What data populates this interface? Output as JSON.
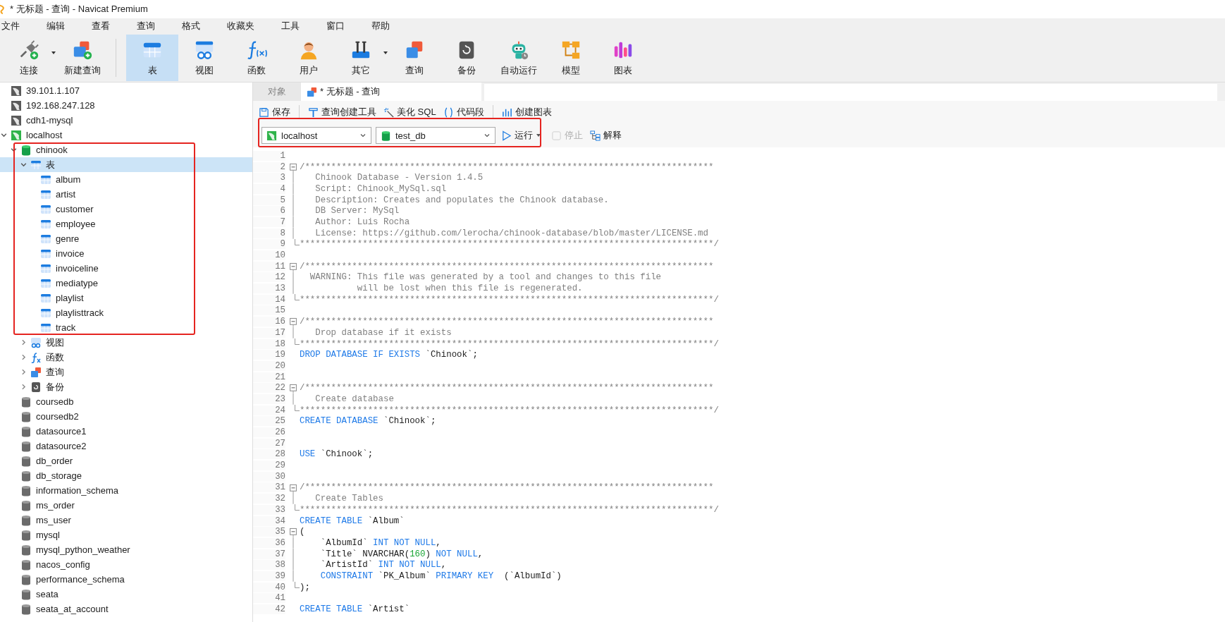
{
  "window": {
    "title": "* 无标题 - 查询 - Navicat Premium"
  },
  "menu": [
    "文件",
    "编辑",
    "查看",
    "查询",
    "格式",
    "收藏夹",
    "工具",
    "窗口",
    "帮助"
  ],
  "toolbar": {
    "groups": [
      [
        {
          "kind": "connect",
          "label": "连接",
          "dropdown": true,
          "selected": false
        },
        {
          "kind": "new-query",
          "label": "新建查询",
          "dropdown": false,
          "selected": false
        }
      ],
      [
        {
          "kind": "table",
          "label": "表",
          "dropdown": false,
          "selected": true
        },
        {
          "kind": "view",
          "label": "视图",
          "dropdown": false,
          "selected": false
        },
        {
          "kind": "function",
          "label": "函数",
          "dropdown": false,
          "selected": false
        },
        {
          "kind": "user",
          "label": "用户",
          "dropdown": false,
          "selected": false
        },
        {
          "kind": "tools",
          "label": "其它",
          "dropdown": true,
          "selected": false
        },
        {
          "kind": "query",
          "label": "查询",
          "dropdown": false,
          "selected": false
        },
        {
          "kind": "backup",
          "label": "备份",
          "dropdown": false,
          "selected": false
        },
        {
          "kind": "robot",
          "label": "自动运行",
          "dropdown": false,
          "selected": false
        },
        {
          "kind": "model",
          "label": "模型",
          "dropdown": false,
          "selected": false
        },
        {
          "kind": "chart",
          "label": "图表",
          "dropdown": false,
          "selected": false
        }
      ]
    ]
  },
  "tree": [
    {
      "kind": "server",
      "label": "39.101.1.107",
      "open": false,
      "selected": false
    },
    {
      "kind": "server",
      "label": "192.168.247.128",
      "open": false,
      "selected": false
    },
    {
      "kind": "server",
      "label": "cdh1-mysql",
      "open": false,
      "selected": false
    },
    {
      "kind": "server",
      "label": "localhost",
      "open": true,
      "selected": false,
      "expanded": true,
      "children": [
        {
          "kind": "database",
          "label": "chinook",
          "open": true,
          "selected": false,
          "expanded": true,
          "children": [
            {
              "kind": "tables",
              "label": "表",
              "selected": true,
              "expanded": true,
              "children": [
                {
                  "kind": "table",
                  "label": "album",
                  "selected": false
                },
                {
                  "kind": "table",
                  "label": "artist",
                  "selected": false
                },
                {
                  "kind": "table",
                  "label": "customer",
                  "selected": false
                },
                {
                  "kind": "table",
                  "label": "employee",
                  "selected": false
                },
                {
                  "kind": "table",
                  "label": "genre",
                  "selected": false
                },
                {
                  "kind": "table",
                  "label": "invoice",
                  "selected": false
                },
                {
                  "kind": "table",
                  "label": "invoiceline",
                  "selected": false
                },
                {
                  "kind": "table",
                  "label": "mediatype",
                  "selected": false
                },
                {
                  "kind": "table",
                  "label": "playlist",
                  "selected": false
                },
                {
                  "kind": "table",
                  "label": "playlisttrack",
                  "selected": false
                },
                {
                  "kind": "table",
                  "label": "track",
                  "selected": false
                }
              ]
            },
            {
              "kind": "views",
              "label": "视图",
              "selected": false,
              "expanded": false
            },
            {
              "kind": "functions",
              "label": "函数",
              "selected": false,
              "expanded": false
            },
            {
              "kind": "queries",
              "label": "查询",
              "selected": false,
              "expanded": false
            },
            {
              "kind": "backups",
              "label": "备份",
              "selected": false,
              "expanded": false
            }
          ]
        },
        {
          "kind": "database",
          "label": "coursedb",
          "open": false,
          "selected": false
        },
        {
          "kind": "database",
          "label": "coursedb2",
          "open": false,
          "selected": false
        },
        {
          "kind": "database",
          "label": "datasource1",
          "open": false,
          "selected": false
        },
        {
          "kind": "database",
          "label": "datasource2",
          "open": false,
          "selected": false
        },
        {
          "kind": "database",
          "label": "db_order",
          "open": false,
          "selected": false
        },
        {
          "kind": "database",
          "label": "db_storage",
          "open": false,
          "selected": false
        },
        {
          "kind": "database",
          "label": "information_schema",
          "open": false,
          "selected": false
        },
        {
          "kind": "database",
          "label": "ms_order",
          "open": false,
          "selected": false
        },
        {
          "kind": "database",
          "label": "ms_user",
          "open": false,
          "selected": false
        },
        {
          "kind": "database",
          "label": "mysql",
          "open": false,
          "selected": false
        },
        {
          "kind": "database",
          "label": "mysql_python_weather",
          "open": false,
          "selected": false
        },
        {
          "kind": "database",
          "label": "nacos_config",
          "open": false,
          "selected": false
        },
        {
          "kind": "database",
          "label": "performance_schema",
          "open": false,
          "selected": false
        },
        {
          "kind": "database",
          "label": "seata",
          "open": false,
          "selected": false
        },
        {
          "kind": "database",
          "label": "seata_at_account",
          "open": false,
          "selected": false
        }
      ]
    }
  ],
  "tabs": [
    {
      "label": "对象",
      "kind": "plain",
      "selected": false
    },
    {
      "label": "* 无标题 - 查询",
      "kind": "query",
      "selected": true
    }
  ],
  "editor_toolbar": [
    {
      "kind": "save",
      "label": "保存"
    },
    {
      "kind": "builder",
      "label": "查询创建工具"
    },
    {
      "kind": "beautify",
      "label": "美化 SQL"
    },
    {
      "kind": "snippet",
      "label": "代码段"
    },
    {
      "kind": "chart",
      "label": "创建图表"
    }
  ],
  "run_bar": {
    "connection": "localhost",
    "database": "test_db",
    "run": "运行",
    "stop": "停止",
    "stop_disabled": true,
    "explain": "解释"
  },
  "code": [
    {
      "n": "1",
      "kind": "plain"
    },
    {
      "n": "2",
      "kind": "fold-start",
      "tokens": [
        {
          "kind": "comment",
          "text": "/******************************************************************************"
        }
      ]
    },
    {
      "n": "3",
      "kind": "fold-body",
      "tokens": [
        {
          "kind": "comment",
          "text": "   Chinook Database - Version 1.4.5"
        }
      ]
    },
    {
      "n": "4",
      "kind": "fold-body",
      "tokens": [
        {
          "kind": "comment",
          "text": "   Script: Chinook_MySql.sql"
        }
      ]
    },
    {
      "n": "5",
      "kind": "fold-body",
      "tokens": [
        {
          "kind": "comment",
          "text": "   Description: Creates and populates the Chinook database."
        }
      ]
    },
    {
      "n": "6",
      "kind": "fold-body",
      "tokens": [
        {
          "kind": "comment",
          "text": "   DB Server: MySql"
        }
      ]
    },
    {
      "n": "7",
      "kind": "fold-body",
      "tokens": [
        {
          "kind": "comment",
          "text": "   Author: Luis Rocha"
        }
      ]
    },
    {
      "n": "8",
      "kind": "fold-body",
      "tokens": [
        {
          "kind": "comment",
          "text": "   License: https://github.com/lerocha/chinook-database/blob/master/LICENSE.md"
        }
      ]
    },
    {
      "n": "9",
      "kind": "fold-end",
      "tokens": [
        {
          "kind": "comment",
          "text": "*******************************************************************************/"
        }
      ]
    },
    {
      "n": "10",
      "kind": "plain"
    },
    {
      "n": "11",
      "kind": "fold-start",
      "tokens": [
        {
          "kind": "comment",
          "text": "/******************************************************************************"
        }
      ]
    },
    {
      "n": "12",
      "kind": "fold-body",
      "tokens": [
        {
          "kind": "comment",
          "text": "  WARNING: This file was generated by a tool and changes to this file"
        }
      ]
    },
    {
      "n": "13",
      "kind": "fold-body",
      "tokens": [
        {
          "kind": "comment",
          "text": "           will be lost when this file is regenerated."
        }
      ]
    },
    {
      "n": "14",
      "kind": "fold-end",
      "tokens": [
        {
          "kind": "comment",
          "text": "*******************************************************************************/"
        }
      ]
    },
    {
      "n": "15",
      "kind": "plain"
    },
    {
      "n": "16",
      "kind": "fold-start",
      "tokens": [
        {
          "kind": "comment",
          "text": "/******************************************************************************"
        }
      ]
    },
    {
      "n": "17",
      "kind": "fold-body",
      "tokens": [
        {
          "kind": "comment",
          "text": "   Drop database if it exists"
        }
      ]
    },
    {
      "n": "18",
      "kind": "fold-end",
      "tokens": [
        {
          "kind": "comment",
          "text": "*******************************************************************************/"
        }
      ]
    },
    {
      "n": "19",
      "kind": "plain",
      "tokens": [
        {
          "kind": "keyword",
          "text": "DROP DATABASE IF EXISTS"
        },
        {
          "kind": "plain",
          "text": " `Chinook`;"
        }
      ]
    },
    {
      "n": "20",
      "kind": "plain"
    },
    {
      "n": "21",
      "kind": "plain"
    },
    {
      "n": "22",
      "kind": "fold-start",
      "tokens": [
        {
          "kind": "comment",
          "text": "/******************************************************************************"
        }
      ]
    },
    {
      "n": "23",
      "kind": "fold-body",
      "tokens": [
        {
          "kind": "comment",
          "text": "   Create database"
        }
      ]
    },
    {
      "n": "24",
      "kind": "fold-end",
      "tokens": [
        {
          "kind": "comment",
          "text": "*******************************************************************************/"
        }
      ]
    },
    {
      "n": "25",
      "kind": "plain",
      "tokens": [
        {
          "kind": "keyword",
          "text": "CREATE DATABASE"
        },
        {
          "kind": "plain",
          "text": " `Chinook`;"
        }
      ]
    },
    {
      "n": "26",
      "kind": "plain"
    },
    {
      "n": "27",
      "kind": "plain"
    },
    {
      "n": "28",
      "kind": "plain",
      "tokens": [
        {
          "kind": "keyword",
          "text": "USE"
        },
        {
          "kind": "plain",
          "text": " `Chinook`;"
        }
      ]
    },
    {
      "n": "29",
      "kind": "plain"
    },
    {
      "n": "30",
      "kind": "plain"
    },
    {
      "n": "31",
      "kind": "fold-start",
      "tokens": [
        {
          "kind": "comment",
          "text": "/******************************************************************************"
        }
      ]
    },
    {
      "n": "32",
      "kind": "fold-body",
      "tokens": [
        {
          "kind": "comment",
          "text": "   Create Tables"
        }
      ]
    },
    {
      "n": "33",
      "kind": "fold-end",
      "tokens": [
        {
          "kind": "comment",
          "text": "*******************************************************************************/"
        }
      ]
    },
    {
      "n": "34",
      "kind": "plain",
      "tokens": [
        {
          "kind": "keyword",
          "text": "CREATE TABLE"
        },
        {
          "kind": "plain",
          "text": " `Album`"
        }
      ]
    },
    {
      "n": "35",
      "kind": "fold-start",
      "tokens": [
        {
          "kind": "plain",
          "text": "("
        }
      ]
    },
    {
      "n": "36",
      "kind": "fold-body",
      "tokens": [
        {
          "kind": "plain",
          "text": "    `AlbumId` "
        },
        {
          "kind": "keyword",
          "text": "INT NOT NULL"
        },
        {
          "kind": "plain",
          "text": ","
        }
      ]
    },
    {
      "n": "37",
      "kind": "fold-body",
      "tokens": [
        {
          "kind": "plain",
          "text": "    `Title` NVARCHAR("
        },
        {
          "kind": "number",
          "text": "160"
        },
        {
          "kind": "plain",
          "text": ") "
        },
        {
          "kind": "keyword",
          "text": "NOT NULL"
        },
        {
          "kind": "plain",
          "text": ","
        }
      ]
    },
    {
      "n": "38",
      "kind": "fold-body",
      "tokens": [
        {
          "kind": "plain",
          "text": "    `ArtistId` "
        },
        {
          "kind": "keyword",
          "text": "INT NOT NULL"
        },
        {
          "kind": "plain",
          "text": ","
        }
      ]
    },
    {
      "n": "39",
      "kind": "fold-body",
      "tokens": [
        {
          "kind": "keyword",
          "text": "    CONSTRAINT"
        },
        {
          "kind": "plain",
          "text": " `PK_Album` "
        },
        {
          "kind": "keyword",
          "text": "PRIMARY KEY"
        },
        {
          "kind": "plain",
          "text": "  (`AlbumId`)"
        }
      ]
    },
    {
      "n": "40",
      "kind": "fold-end",
      "tokens": [
        {
          "kind": "plain",
          "text": ");"
        }
      ]
    },
    {
      "n": "41",
      "kind": "plain"
    },
    {
      "n": "42",
      "kind": "plain",
      "tokens": [
        {
          "kind": "keyword",
          "text": "CREATE TABLE"
        },
        {
          "kind": "plain",
          "text": " `Artist`"
        }
      ]
    }
  ]
}
